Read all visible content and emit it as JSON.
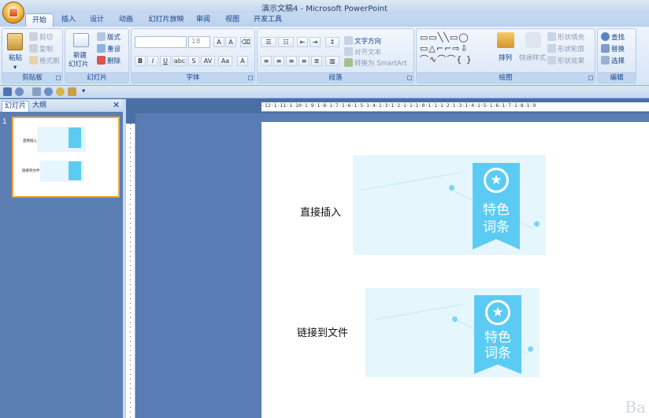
{
  "window": {
    "title": "演示文稿4 - Microsoft PowerPoint"
  },
  "tabs": [
    "开始",
    "插入",
    "设计",
    "动画",
    "幻灯片放映",
    "审阅",
    "视图",
    "开发工具"
  ],
  "clipboard": {
    "paste": "粘贴",
    "cut": "剪切",
    "copy": "复制",
    "format_painter": "格式刷",
    "label": "剪贴板"
  },
  "slides_group": {
    "new_slide_1": "新建",
    "new_slide_2": "幻灯片",
    "layout": "版式",
    "reset": "重设",
    "delete": "删除",
    "label": "幻灯片"
  },
  "font_group": {
    "size": "18",
    "label": "字体"
  },
  "paragraph": {
    "text_direction": "文字方向",
    "align_text": "对齐文本",
    "convert_smartart": "转换为 SmartArt",
    "label": "段落"
  },
  "drawing": {
    "arrange": "排列",
    "quick_styles": "快速样式",
    "shape_fill": "形状填充",
    "shape_outline": "形状轮廓",
    "shape_effects": "形状效果",
    "label": "绘图"
  },
  "editing": {
    "find": "查找",
    "replace": "替换",
    "select": "选择",
    "label": "编辑"
  },
  "panel": {
    "tab_slides": "幻灯片",
    "tab_outline": "大纲",
    "slide_number": "1",
    "thumb_label1": "直接插入",
    "thumb_label2": "链接到文件"
  },
  "ruler": {
    "h": "·12·1·11·1·10·1·9·1·8·1·7·1·6·1·5·1·4·1·3·1·2·1·1·1·0·1·1·1·2·1·3·1·4·1·5·1·6·1·7·1·8·1·9"
  },
  "slide": {
    "label1": "直接插入",
    "label2": "链接到文件",
    "banner_line1": "特色",
    "banner_line2": "词条"
  },
  "watermark": "Ba",
  "colors": {
    "banner": "#5ccbf3",
    "ribbon_text": "#15428b",
    "accent": "#f2a53b"
  }
}
